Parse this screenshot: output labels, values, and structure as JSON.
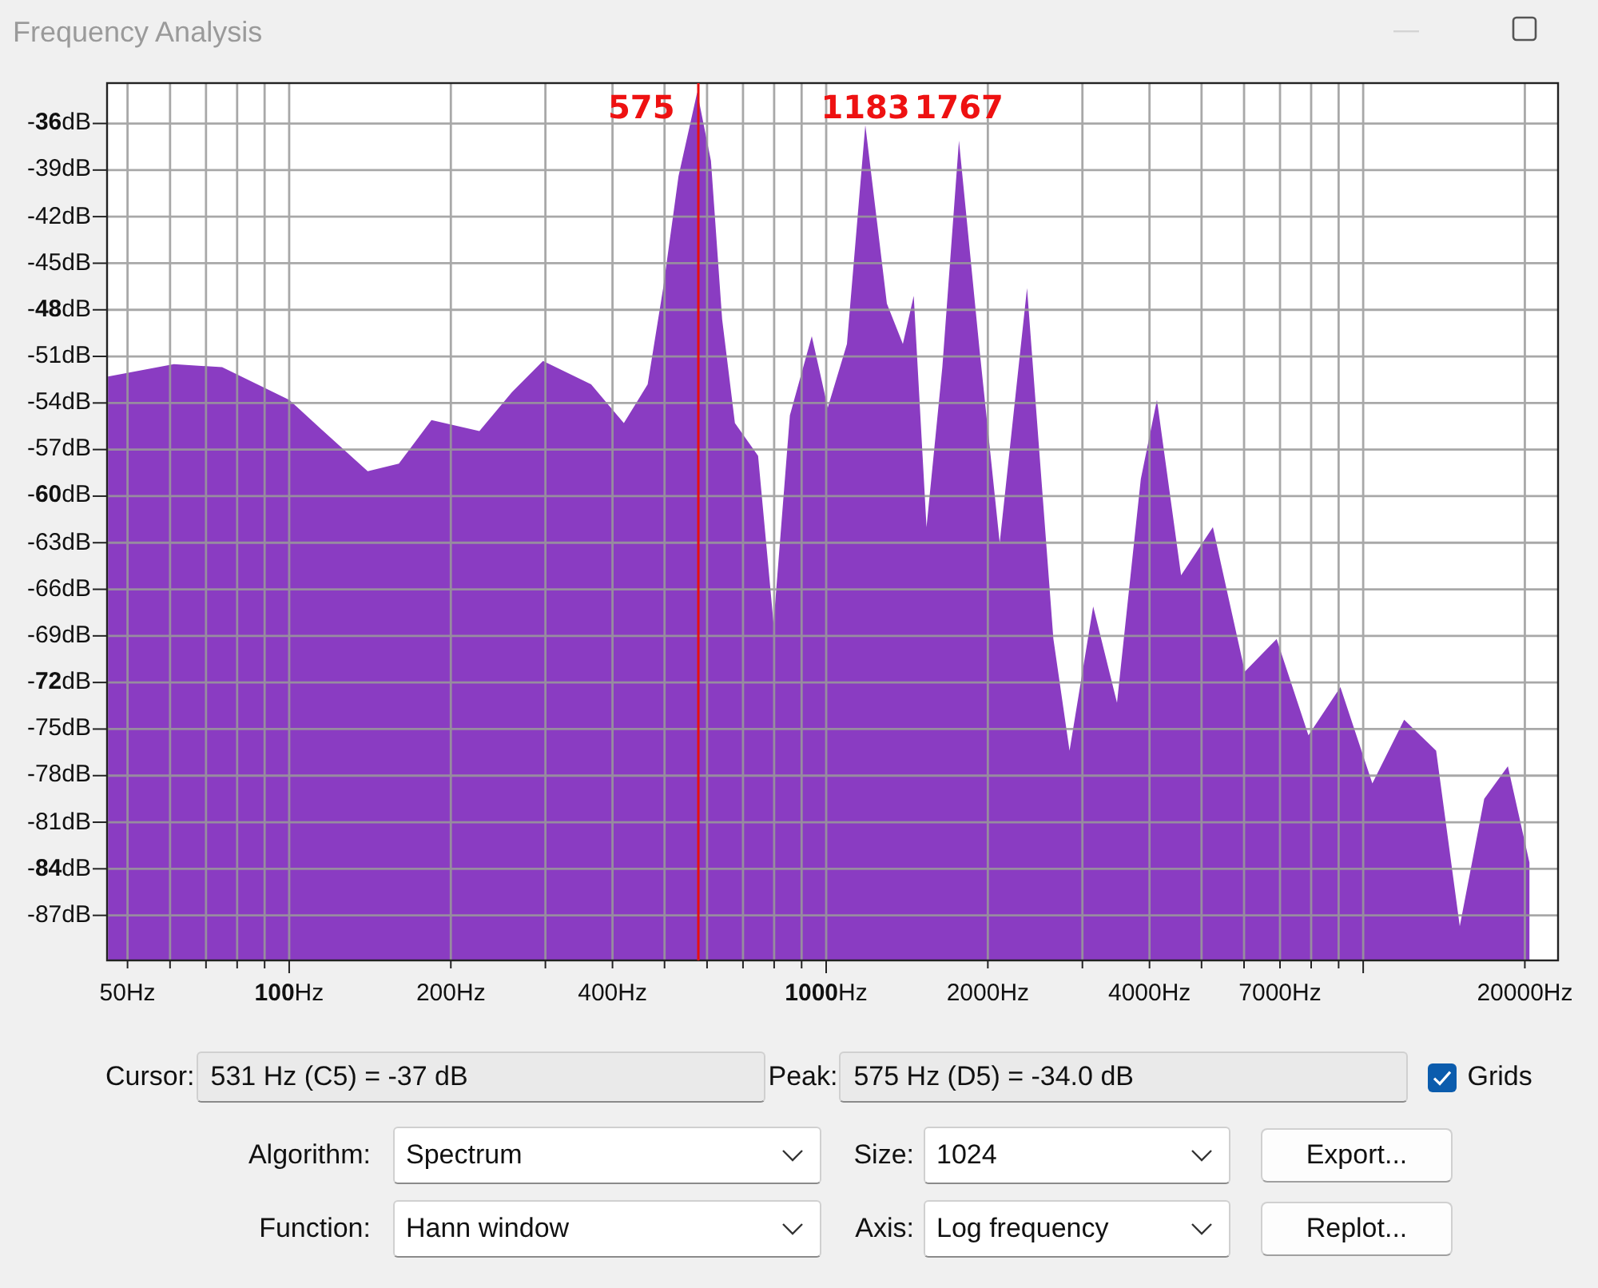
{
  "window": {
    "title": "Frequency Analysis"
  },
  "spectrum": {
    "peak_labels": [
      "575",
      "1183",
      "1767"
    ],
    "y_labels": [
      "-**36**dB",
      "-39dB",
      "-42dB",
      "-45dB",
      "-**48**dB",
      "-51dB",
      "-54dB",
      "-57dB",
      "-**60**dB",
      "-63dB",
      "-66dB",
      "-69dB",
      "-**72**dB",
      "-75dB",
      "-78dB",
      "-81dB",
      "-**84**dB",
      "-87dB"
    ],
    "x_labels": [
      "50Hz",
      "**100**Hz",
      "200Hz",
      "400Hz",
      "**1000**Hz",
      "2000Hz",
      "4000Hz",
      "7000Hz",
      "20000Hz"
    ]
  },
  "readouts": [
    {
      "label": "Cursor:",
      "value": "531 Hz (C5) = -37 dB"
    },
    {
      "label": "Peak:",
      "value": "575 Hz (D5) = -34.0 dB"
    }
  ],
  "grids": {
    "label": "Grids",
    "checked": true
  },
  "settings": [
    {
      "selects": [
        {
          "label": "Algorithm:",
          "value": "Spectrum"
        },
        {
          "label": "Size:",
          "value": "1024"
        }
      ],
      "button": "Export..."
    },
    {
      "selects": [
        {
          "label": "Function:",
          "value": "Hann window"
        },
        {
          "label": "Axis:",
          "value": "Log frequency"
        }
      ],
      "button": "Replot..."
    }
  ]
}
